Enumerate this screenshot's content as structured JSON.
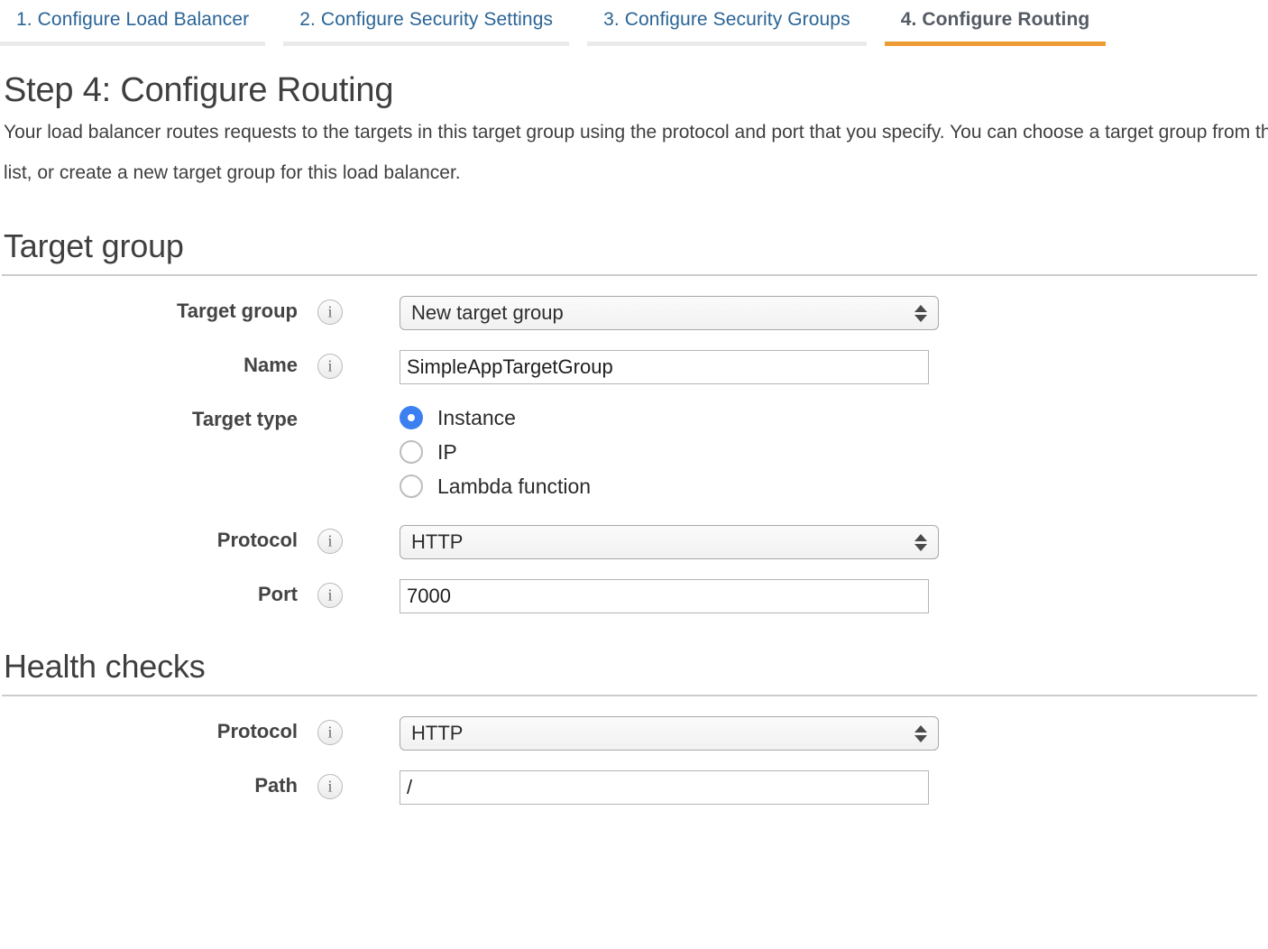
{
  "wizard": {
    "tabs": [
      {
        "label": "1. Configure Load Balancer",
        "active": false
      },
      {
        "label": "2. Configure Security Settings",
        "active": false
      },
      {
        "label": "3. Configure Security Groups",
        "active": false
      },
      {
        "label": "4. Configure Routing",
        "active": true
      }
    ],
    "active_color": "#ec9c33",
    "link_color": "#2a6496"
  },
  "step": {
    "heading": "Step 4: Configure Routing",
    "description": "Your load balancer routes requests to the targets in this target group using the protocol and port that you specify. You can choose a target group from the list, or create a new target group for this load balancer."
  },
  "target_group_section": {
    "title": "Target group",
    "target_group": {
      "label": "Target group",
      "info": "i",
      "value": "New target group"
    },
    "name": {
      "label": "Name",
      "info": "i",
      "value": "SimpleAppTargetGroup",
      "placeholder": ""
    },
    "target_type": {
      "label": "Target type",
      "options": [
        {
          "label": "Instance",
          "selected": true
        },
        {
          "label": "IP",
          "selected": false
        },
        {
          "label": "Lambda function",
          "selected": false
        }
      ],
      "selected_color": "#3b7ff0"
    },
    "protocol": {
      "label": "Protocol",
      "info": "i",
      "value": "HTTP"
    },
    "port": {
      "label": "Port",
      "info": "i",
      "value": "7000",
      "placeholder": ""
    }
  },
  "health_checks_section": {
    "title": "Health checks",
    "protocol": {
      "label": "Protocol",
      "info": "i",
      "value": "HTTP"
    },
    "path": {
      "label": "Path",
      "info": "i",
      "value": "/",
      "placeholder": ""
    }
  }
}
